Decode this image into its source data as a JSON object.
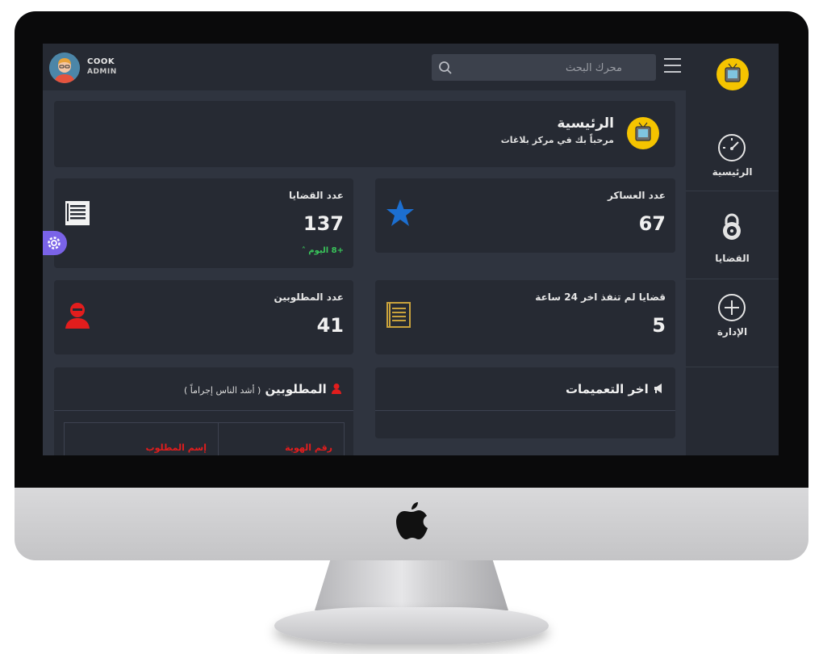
{
  "user": {
    "name": "COOK",
    "role": "ADMIN"
  },
  "search": {
    "placeholder": "محرك البحث"
  },
  "sidebar": {
    "items": [
      {
        "label": "الرئيسية",
        "icon": "speedometer-icon"
      },
      {
        "label": "القضايا",
        "icon": "padlock-icon"
      },
      {
        "label": "الإدارة",
        "icon": "plus-circle-icon"
      }
    ]
  },
  "header": {
    "title": "الرئيسية",
    "subtitle": "مرحباً بك في مركز بلاغات"
  },
  "stats": {
    "cases": {
      "title": "عدد القضايا",
      "value": "137",
      "trend": "+8 اليوم ˄",
      "icon": "document-icon"
    },
    "camps": {
      "title": "عدد العساكر",
      "value": "67",
      "icon": "star-icon",
      "icon_color": "#1c6fd1"
    },
    "wanted": {
      "title": "عدد المطلوبين",
      "value": "41",
      "icon": "person-icon",
      "icon_color": "#e21d1d"
    },
    "pending": {
      "title": "قضايا لم تنفذ اخر 24 ساعة",
      "value": "5",
      "icon": "notebook-icon",
      "icon_color": "#c9a23c"
    }
  },
  "wanted_panel": {
    "title": "المطلوبين",
    "subtitle": "( أشد الناس إجراماً )",
    "columns": [
      "رقم الهوية",
      "إسم المطلوب"
    ]
  },
  "announcements_panel": {
    "title": "اخر التعميمات"
  },
  "colors": {
    "accent": "#f5c400",
    "danger": "#e21d1d",
    "success": "#39c45a",
    "settings": "#7a63e8"
  }
}
